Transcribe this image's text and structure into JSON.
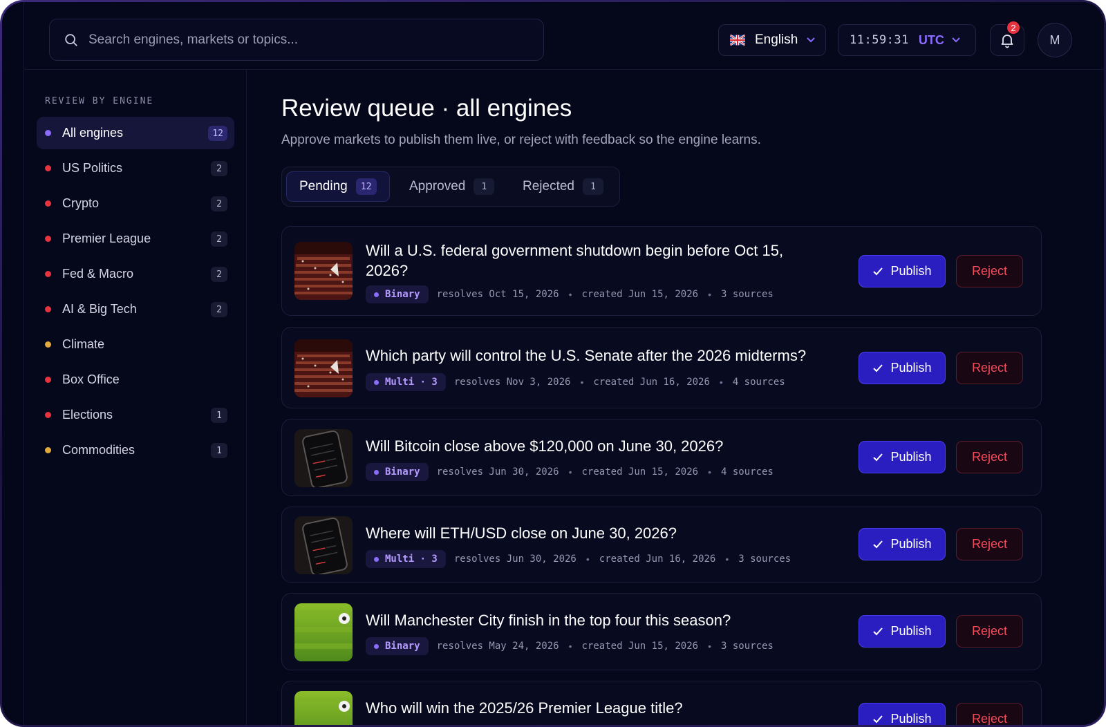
{
  "search": {
    "placeholder": "Search engines, markets or topics..."
  },
  "header": {
    "language": "English",
    "time": "11:59:31",
    "timezone": "UTC",
    "notifications_count": "2",
    "avatar_initial": "M"
  },
  "sidebar": {
    "heading": "REVIEW BY ENGINE",
    "items": [
      {
        "label": "All engines",
        "count": "12",
        "color": "#8b6cff"
      },
      {
        "label": "US Politics",
        "count": "2",
        "color": "#e5343f"
      },
      {
        "label": "Crypto",
        "count": "2",
        "color": "#e5343f"
      },
      {
        "label": "Premier League",
        "count": "2",
        "color": "#e5343f"
      },
      {
        "label": "Fed & Macro",
        "count": "2",
        "color": "#e5343f"
      },
      {
        "label": "AI & Big Tech",
        "count": "2",
        "color": "#e5343f"
      },
      {
        "label": "Climate",
        "count": "",
        "color": "#e2a93b"
      },
      {
        "label": "Box Office",
        "count": "",
        "color": "#e5343f"
      },
      {
        "label": "Elections",
        "count": "1",
        "color": "#e5343f"
      },
      {
        "label": "Commodities",
        "count": "1",
        "color": "#e2a93b"
      }
    ]
  },
  "main": {
    "title": "Review queue · all engines",
    "subtitle": "Approve markets to publish them live, or reject with feedback so the engine learns.",
    "tabs": [
      {
        "label": "Pending",
        "count": "12"
      },
      {
        "label": "Approved",
        "count": "1"
      },
      {
        "label": "Rejected",
        "count": "1"
      }
    ],
    "publish_label": "Publish",
    "reject_label": "Reject",
    "cards": [
      {
        "question": "Will a U.S. federal government shutdown begin before Oct 15, 2026?",
        "type": "Binary",
        "resolves": "resolves Oct 15, 2026",
        "created": "created Jun 15, 2026",
        "sources": "3 sources",
        "thumb": "parliament-image"
      },
      {
        "question": "Which party will control the U.S. Senate after the 2026 midterms?",
        "type": "Multi · 3",
        "resolves": "resolves Nov 3, 2026",
        "created": "created Jun 16, 2026",
        "sources": "4 sources",
        "thumb": "parliament-image"
      },
      {
        "question": "Will Bitcoin close above $120,000 on June 30, 2026?",
        "type": "Binary",
        "resolves": "resolves Jun 30, 2026",
        "created": "created Jun 15, 2026",
        "sources": "4 sources",
        "thumb": "phone-chart-image"
      },
      {
        "question": "Where will ETH/USD close on June 30, 2026?",
        "type": "Multi · 3",
        "resolves": "resolves Jun 30, 2026",
        "created": "created Jun 16, 2026",
        "sources": "3 sources",
        "thumb": "phone-chart-image"
      },
      {
        "question": "Will Manchester City finish in the top four this season?",
        "type": "Binary",
        "resolves": "resolves May 24, 2026",
        "created": "created Jun 15, 2026",
        "sources": "3 sources",
        "thumb": "football-pitch-image"
      },
      {
        "question": "Who will win the 2025/26 Premier League title?",
        "thumb": "football-pitch-image"
      }
    ]
  }
}
